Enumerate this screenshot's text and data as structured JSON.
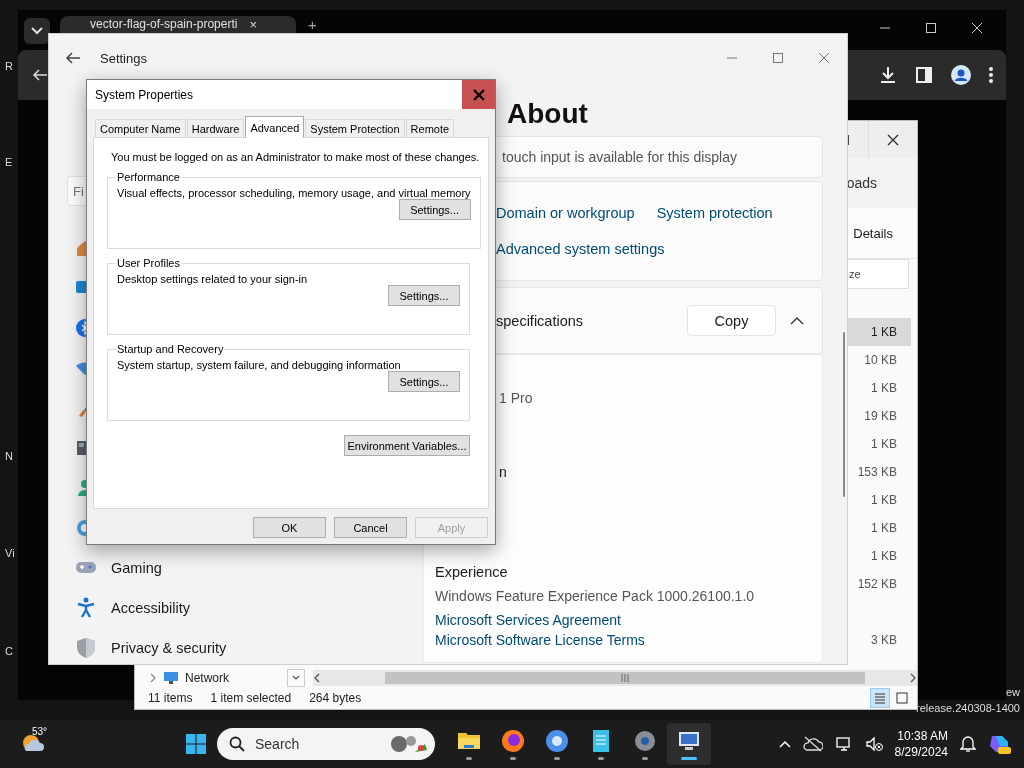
{
  "desktop": {
    "icon_labels": [
      "R",
      "E",
      "N",
      "Vi",
      "C"
    ],
    "build_text": [
      "ew",
      "release.240308-1400"
    ]
  },
  "browser": {
    "tab_title": "vector-flag-of-spain-properti",
    "tab_close": "×",
    "new_tab": "+"
  },
  "explorer": {
    "tab_title": "oads",
    "details_label": "Details",
    "column_header": "ze",
    "rows": [
      {
        "size": "1 KB",
        "selected": true
      },
      {
        "size": "10 KB",
        "selected": false
      },
      {
        "size": "1 KB",
        "selected": false
      },
      {
        "size": "19 KB",
        "selected": false
      },
      {
        "size": "1 KB",
        "selected": false
      },
      {
        "size": "153 KB",
        "selected": false
      },
      {
        "size": "1 KB",
        "selected": false
      },
      {
        "size": "1 KB",
        "selected": false
      },
      {
        "size": "1 KB",
        "selected": false
      },
      {
        "size": "152 KB",
        "selected": false
      },
      {
        "size": "3 KB",
        "selected": false
      }
    ],
    "nav_item": "Network",
    "status": [
      "11 items",
      "1 item selected",
      "264 bytes"
    ],
    "views": [
      {
        "selected": true
      },
      {
        "selected": false
      }
    ]
  },
  "settings": {
    "title": "Settings",
    "search_placeholder": "Fi",
    "nav": [
      {
        "label": "Gaming"
      },
      {
        "label": "Accessibility"
      },
      {
        "label": "Privacy & security"
      }
    ],
    "heading": "About",
    "touch_text": "touch input is available for this display",
    "related_links": [
      "Domain or workgroup",
      "System protection",
      "Advanced system settings"
    ],
    "specs": {
      "title": "specifications",
      "copy_button": "Copy",
      "expanded": true,
      "fragments": [
        "1 Pro",
        "n"
      ]
    },
    "experience": {
      "label": "Experience",
      "value": "Windows Feature Experience Pack 1000.26100.1.0",
      "links": [
        "Microsoft Services Agreement",
        "Microsoft Software License Terms"
      ]
    }
  },
  "dialog": {
    "title": "System Properties",
    "tabs": [
      {
        "label": "Computer Name",
        "selected": false
      },
      {
        "label": "Hardware",
        "selected": false
      },
      {
        "label": "Advanced",
        "selected": true
      },
      {
        "label": "System Protection",
        "selected": false
      },
      {
        "label": "Remote",
        "selected": false
      }
    ],
    "notice": "You must be logged on as an Administrator to make most of these changes.",
    "groups": [
      {
        "title": "Performance",
        "description": "Visual effects, processor scheduling, memory usage, and virtual memory",
        "button": "Settings..."
      },
      {
        "title": "User Profiles",
        "description": "Desktop settings related to your sign-in",
        "button": "Settings..."
      },
      {
        "title": "Startup and Recovery",
        "description": "System startup, system failure, and debugging information",
        "button": "Settings..."
      }
    ],
    "env_button": "Environment Variables...",
    "buttons": [
      {
        "label": "OK",
        "disabled": false
      },
      {
        "label": "Cancel",
        "disabled": false
      },
      {
        "label": "Apply",
        "disabled": true
      }
    ]
  },
  "taskbar": {
    "temperature": "53°",
    "search_label": "Search",
    "apps": [
      {
        "selected": false
      },
      {
        "selected": false
      },
      {
        "selected": false
      },
      {
        "selected": false
      },
      {
        "selected": false
      },
      {
        "selected": true
      }
    ],
    "time": "10:38 AM",
    "date": "8/29/2024"
  }
}
